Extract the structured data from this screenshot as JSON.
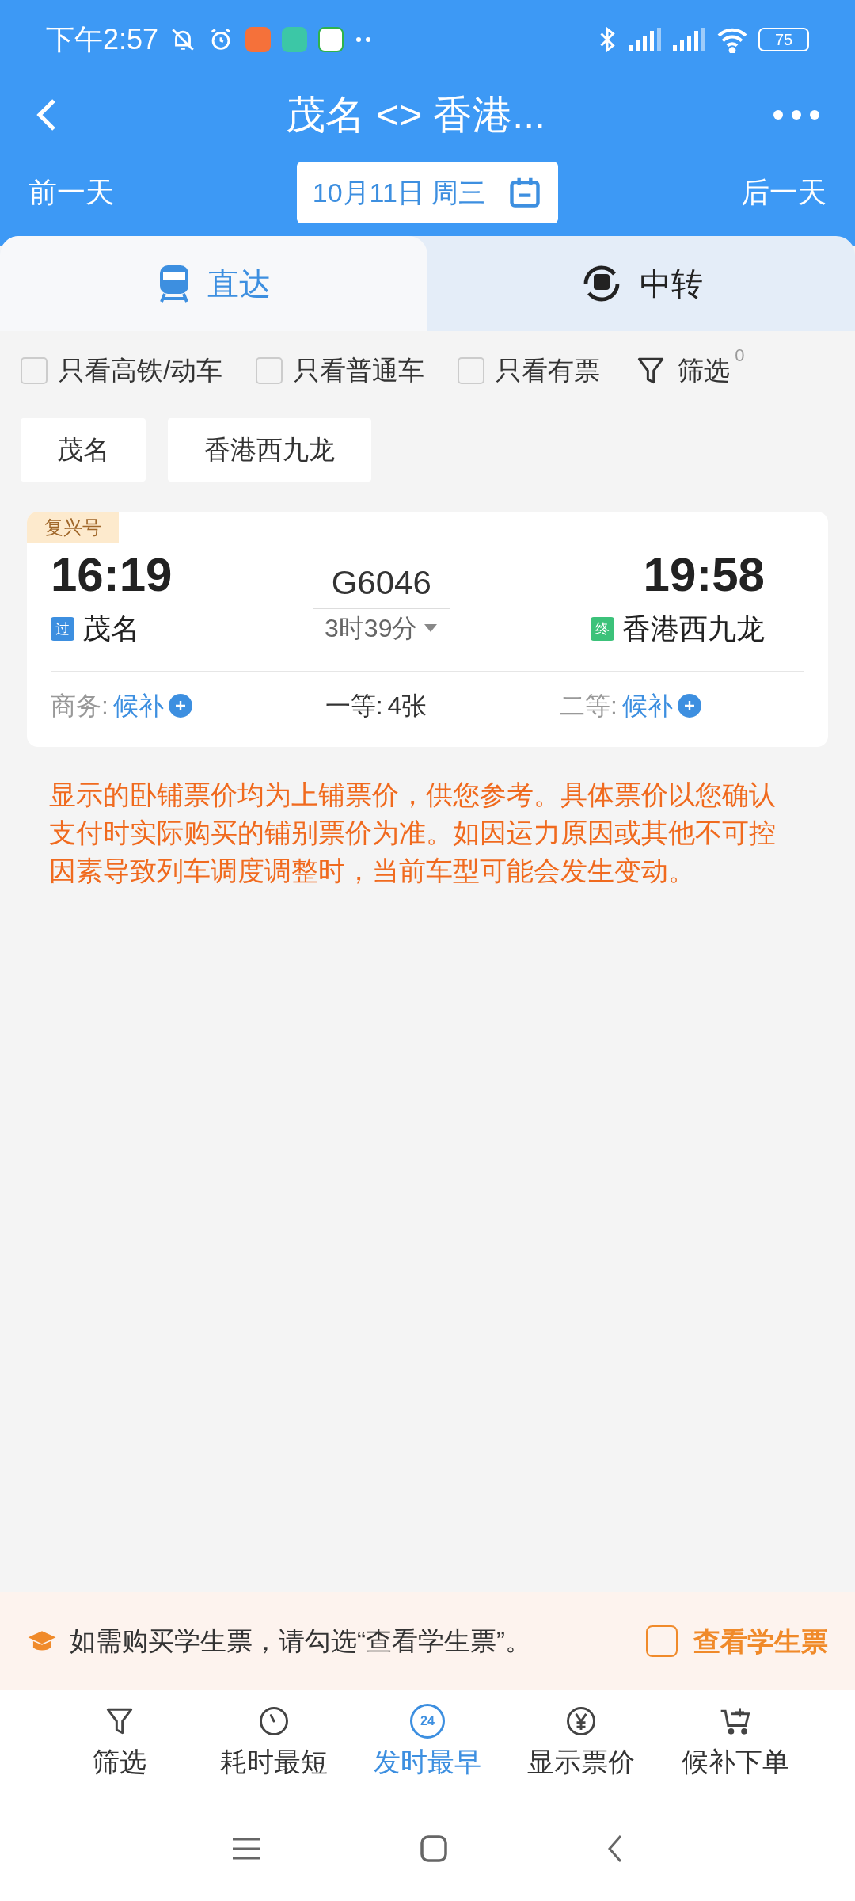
{
  "status_bar": {
    "time": "下午2:57",
    "battery": "75"
  },
  "header": {
    "title": "茂名 <> 香港..."
  },
  "date_bar": {
    "prev": "前一天",
    "date": "10月11日 周三",
    "next": "后一天"
  },
  "tabs": [
    {
      "label": "直达",
      "selected": true
    },
    {
      "label": "中转",
      "selected": false
    }
  ],
  "filters": [
    {
      "label": "只看高铁/动车",
      "checked": false
    },
    {
      "label": "只看普通车",
      "checked": false
    },
    {
      "label": "只看有票",
      "checked": false
    }
  ],
  "filter_button": {
    "label": "筛选",
    "count": "0"
  },
  "stations": [
    "茂名",
    "香港西九龙"
  ],
  "trains": [
    {
      "badge": "复兴号",
      "depart_time": "16:19",
      "depart_tag": "过",
      "depart_station": "茂名",
      "number": "G6046",
      "duration": "3时39分",
      "arrive_time": "19:58",
      "arrive_tag": "终",
      "arrive_station": "香港西九龙",
      "seats": [
        {
          "class": "商务:",
          "value": "候补",
          "waitlist": true
        },
        {
          "class": "一等:",
          "value": "4张",
          "waitlist": false
        },
        {
          "class": "二等:",
          "value": "候补",
          "waitlist": true
        }
      ]
    }
  ],
  "notice": "显示的卧铺票价均为上铺票价，供您参考。具体票价以您确认支付时实际购买的铺别票价为准。如因运力原因或其他不可控因素导致列车调度调整时，当前车型可能会发生变动。",
  "student_bar": {
    "message": "如需购买学生票，请勾选“查看学生票”。",
    "checkbox_label": "查看学生票",
    "checked": false
  },
  "bottom_nav": [
    {
      "kind": "filter",
      "label": "筛选",
      "selected": false
    },
    {
      "kind": "timer",
      "label": "耗时最短",
      "selected": false
    },
    {
      "kind": "clock24",
      "label": "发时最早",
      "icon_text": "24",
      "selected": true
    },
    {
      "kind": "yen",
      "label": "显示票价",
      "selected": false
    },
    {
      "kind": "cart",
      "label": "候补下单",
      "selected": false
    }
  ]
}
